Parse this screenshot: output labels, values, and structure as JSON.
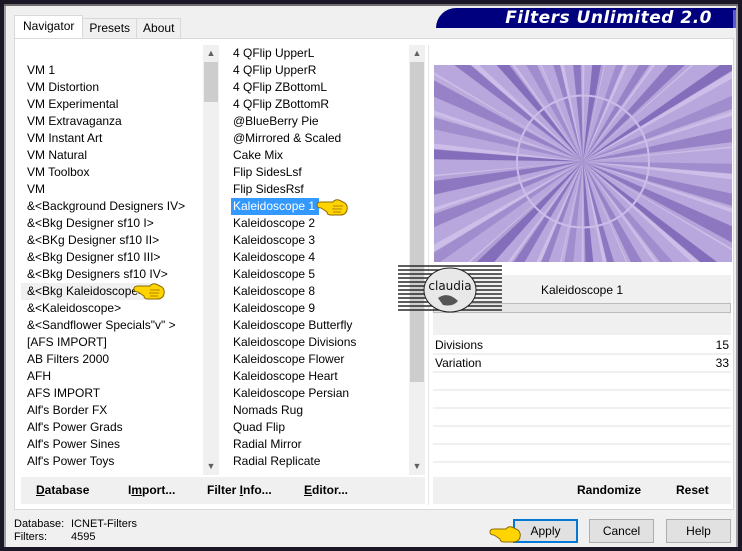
{
  "window": {
    "title": "Filters Unlimited 2.0"
  },
  "tabs": [
    {
      "label": "Navigator",
      "active": true
    },
    {
      "label": "Presets",
      "active": false
    },
    {
      "label": "About",
      "active": false
    }
  ],
  "categories": {
    "items": [
      "VM 1",
      "VM Distortion",
      "VM Experimental",
      "VM Extravaganza",
      "VM Instant Art",
      "VM Natural",
      "VM Toolbox",
      "VM",
      "&<Background Designers IV>",
      "&<Bkg Designer sf10 I>",
      "&<BKg Designer sf10 II>",
      "&<Bkg Designer sf10 III>",
      "&<Bkg Designers sf10 IV>",
      "&<Bkg Kaleidoscope>",
      "&<Kaleidoscope>",
      "&<Sandflower Specials\"v\" >",
      "[AFS IMPORT]",
      "AB Filters 2000",
      "AFH",
      "AFS IMPORT",
      "Alf's Border FX",
      "Alf's Power Grads",
      "Alf's Power Sines",
      "Alf's Power Toys"
    ],
    "highlighted": "&<Bkg Kaleidoscope>"
  },
  "filters": {
    "items": [
      "4 QFlip UpperL",
      "4 QFlip UpperR",
      "4 QFlip ZBottomL",
      "4 QFlip ZBottomR",
      "@BlueBerry Pie",
      "@Mirrored & Scaled",
      "Cake Mix",
      "Flip SidesLsf",
      "Flip SidesRsf",
      "Kaleidoscope 1",
      "Kaleidoscope 2",
      "Kaleidoscope 3",
      "Kaleidoscope 4",
      "Kaleidoscope 5",
      "Kaleidoscope 8",
      "Kaleidoscope 9",
      "Kaleidoscope Butterfly",
      "Kaleidoscope Divisions",
      "Kaleidoscope Flower",
      "Kaleidoscope Heart",
      "Kaleidoscope Persian",
      "Nomads Rug",
      "Quad Flip",
      "Radial Mirror",
      "Radial Replicate"
    ],
    "selected": "Kaleidoscope 1"
  },
  "toolbar": {
    "database": "Database",
    "import": "Import...",
    "filter_info": "Filter Info...",
    "editor": "Editor..."
  },
  "preview": {
    "filter_name": "Kaleidoscope 1"
  },
  "params": [
    {
      "name": "Divisions",
      "value": "15"
    },
    {
      "name": "Variation",
      "value": "33"
    }
  ],
  "right_toolbar": {
    "randomize": "Randomize",
    "reset": "Reset"
  },
  "status": {
    "database_label": "Database:",
    "database_value": "ICNET-Filters",
    "filters_label": "Filters:",
    "filters_value": "4595"
  },
  "buttons": {
    "apply": "Apply",
    "cancel": "Cancel",
    "help": "Help"
  },
  "watermark": {
    "text": "claudia"
  },
  "colors": {
    "banner": "#00007f",
    "selection": "#3399ff",
    "focus": "#0078d7",
    "preview_base": "#b7a7dc",
    "preview_dark": "#5b3fa0",
    "pointer": "#ffd400"
  }
}
